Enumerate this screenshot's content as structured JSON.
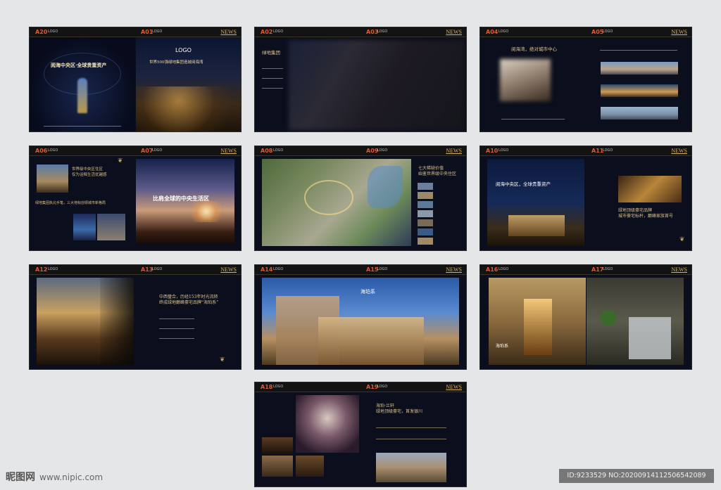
{
  "common": {
    "logo": "LOGO",
    "news": "NEWS"
  },
  "spreads": [
    {
      "left_page": "A20",
      "right_page": "A01",
      "left_headline": "阅海中央区·全球贵重资产",
      "right_logo": "LOGO",
      "right_headline": "世界500强绿地集团造城阅海湾"
    },
    {
      "left_page": "A02",
      "right_page": "A03",
      "left_headline": "绿地集团"
    },
    {
      "left_page": "A04",
      "right_page": "A05",
      "left_headline": "阅海湾，绝对城市中心"
    },
    {
      "left_page": "A06",
      "right_page": "A07",
      "left_headline_1": "世界级中央区住区",
      "left_headline_2": "仅为诠释生活优越感",
      "left_headline_3": "绿地集团执北手笔，三大地标创领城市新格局",
      "right_headline": "比肩全球的中央生活区"
    },
    {
      "left_page": "A08",
      "right_page": "A09",
      "right_headline_1": "七大稀缺价值",
      "right_headline_2": "始鉴世界级中央住区"
    },
    {
      "left_page": "A10",
      "right_page": "A11",
      "left_headline": "阅海中央区，全球贵重资产",
      "right_headline_1": "绿地顶级豪宅品牌",
      "right_headline_2": "城市豪宅标杆，巅峰家族首号"
    },
    {
      "left_page": "A12",
      "right_page": "A13",
      "right_headline_1": "中西璧合，历经153年时光流转",
      "right_headline_2": "终成绿地巅峰豪宅品牌“海珀系”"
    },
    {
      "left_page": "A14",
      "right_page": "A15",
      "center_title": "海珀系"
    },
    {
      "left_page": "A16",
      "right_page": "A17",
      "left_caption": "海珀系"
    },
    {
      "left_page": "A18",
      "right_page": "A19",
      "right_headline_1": "海珀·兰轩",
      "right_headline_2": "绿地顶级豪宅，首发银川"
    }
  ],
  "watermark": {
    "site_name": "昵图网",
    "url": "www.nipic.com"
  },
  "image_id": "ID:9233529 NO:20200914112506542089"
}
